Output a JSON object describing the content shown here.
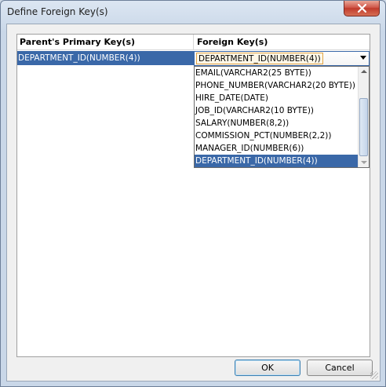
{
  "window": {
    "title": "Define Foreign Key(s)",
    "close_glyph": "✕"
  },
  "grid": {
    "columns": [
      "Parent's Primary Key(s)",
      "Foreign Key(s)"
    ],
    "rows": [
      {
        "primary_key": "DEPARTMENT_ID(NUMBER(4))",
        "foreign_key": "DEPARTMENT_ID(NUMBER(4))"
      }
    ]
  },
  "dropdown": {
    "options": [
      "EMAIL(VARCHAR2(25 BYTE))",
      "PHONE_NUMBER(VARCHAR2(20 BYTE))",
      "HIRE_DATE(DATE)",
      "JOB_ID(VARCHAR2(10 BYTE))",
      "SALARY(NUMBER(8,2))",
      "COMMISSION_PCT(NUMBER(2,2))",
      "MANAGER_ID(NUMBER(6))",
      "DEPARTMENT_ID(NUMBER(4))"
    ],
    "selected_index": 7
  },
  "buttons": {
    "ok": "OK",
    "cancel": "Cancel"
  },
  "colors": {
    "selection": "#3a68a8",
    "combo_focus": "#e1a445",
    "close_button": "#c03b2c"
  }
}
